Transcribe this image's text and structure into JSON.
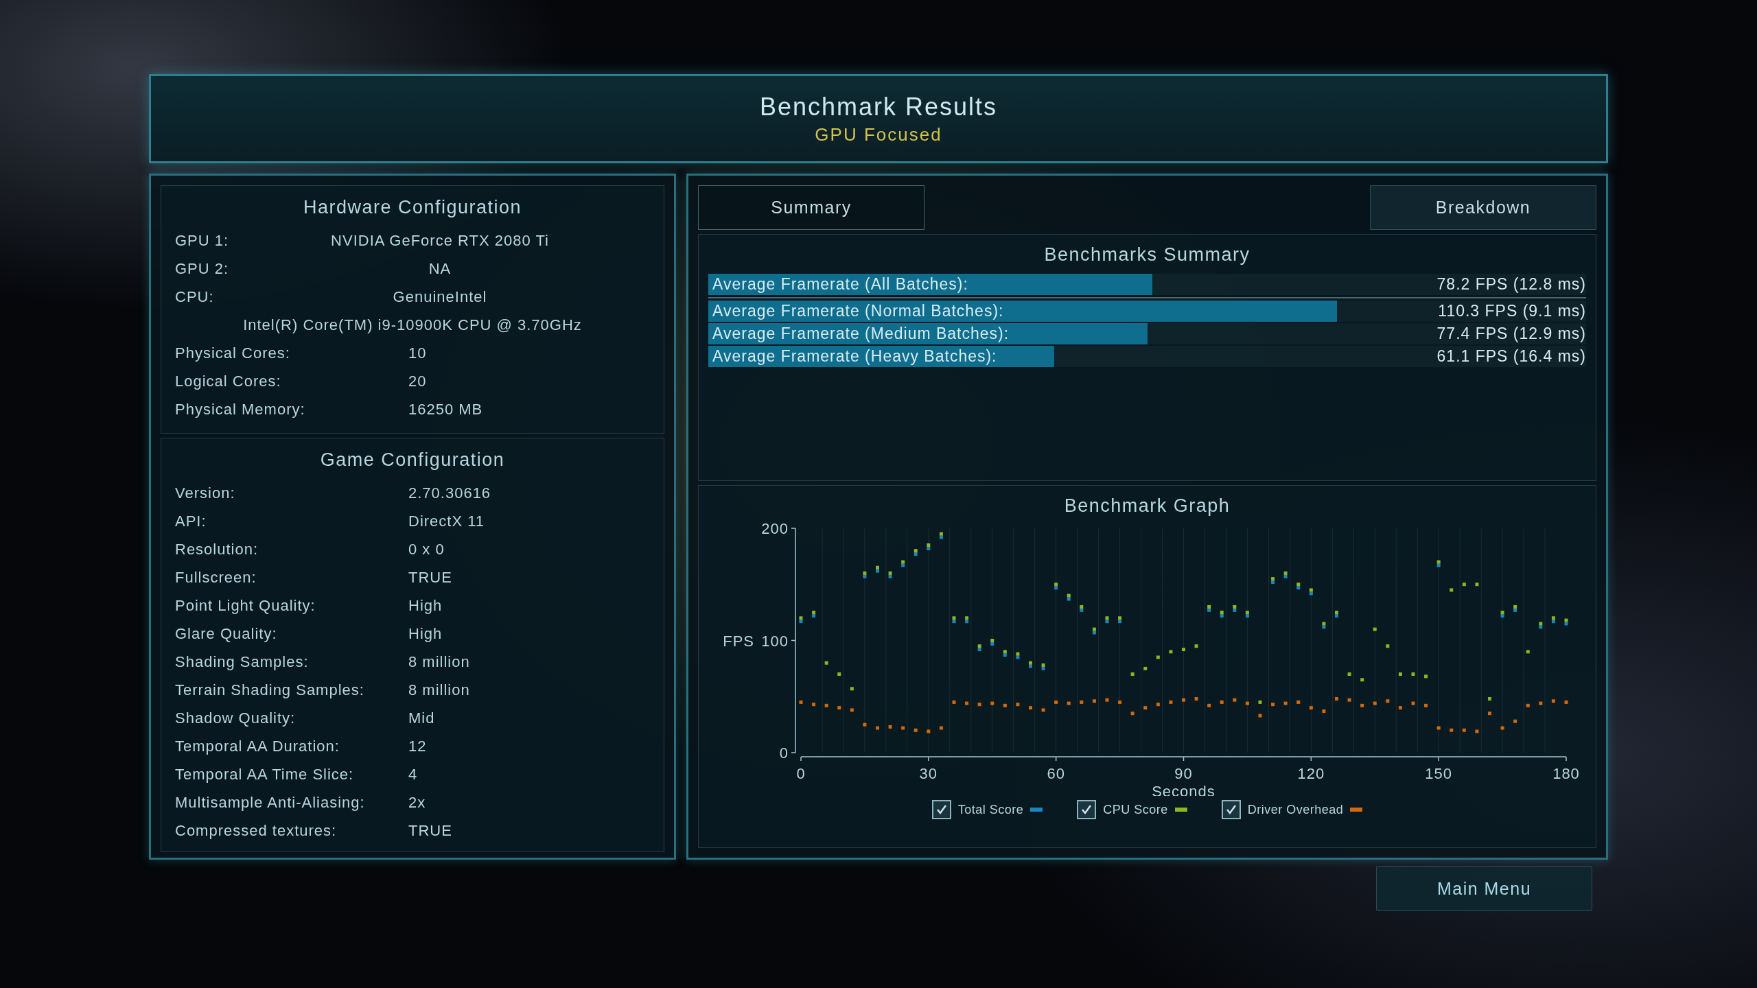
{
  "header": {
    "title": "Benchmark Results",
    "subtitle": "GPU Focused"
  },
  "hardware": {
    "title": "Hardware Configuration",
    "rows": [
      {
        "kind": "centered",
        "label": "GPU 1:",
        "value": "NVIDIA GeForce RTX 2080 Ti"
      },
      {
        "kind": "centered",
        "label": "GPU 2:",
        "value": "NA"
      },
      {
        "kind": "centered",
        "label": "CPU:",
        "value": "GenuineIntel"
      },
      {
        "kind": "line",
        "value": "Intel(R) Core(TM) i9-10900K CPU @ 3.70GHz"
      },
      {
        "kind": "column",
        "label": "Physical Cores:",
        "value": "10"
      },
      {
        "kind": "column",
        "label": "Logical Cores:",
        "value": "20"
      },
      {
        "kind": "column",
        "label": "Physical Memory:",
        "value": "16250  MB"
      }
    ]
  },
  "game": {
    "title": "Game Configuration",
    "rows": [
      {
        "label": "Version:",
        "value": "2.70.30616"
      },
      {
        "label": "API:",
        "value": "DirectX 11"
      },
      {
        "label": "Resolution:",
        "value": "0 x 0"
      },
      {
        "label": "Fullscreen:",
        "value": "TRUE"
      },
      {
        "label": "Point Light Quality:",
        "value": "High"
      },
      {
        "label": "Glare Quality:",
        "value": "High"
      },
      {
        "label": "Shading Samples:",
        "value": "8 million"
      },
      {
        "label": "Terrain Shading Samples:",
        "value": "8 million"
      },
      {
        "label": "Shadow Quality:",
        "value": "Mid"
      },
      {
        "label": "Temporal AA Duration:",
        "value": "12"
      },
      {
        "label": "Temporal AA Time Slice:",
        "value": "4"
      },
      {
        "label": "Multisample Anti-Aliasing:",
        "value": "2x"
      },
      {
        "label": "Compressed textures:",
        "value": "TRUE"
      }
    ]
  },
  "tabs": [
    {
      "label": "Summary",
      "selected": true
    },
    {
      "label": "Breakdown",
      "selected": false
    }
  ],
  "summary": {
    "title": "Benchmarks Summary",
    "rows": [
      {
        "label": "Average Framerate (All Batches):",
        "value": "78.2 FPS (12.8 ms)",
        "level": 0.506
      },
      {
        "label": "Average Framerate (Normal Batches):",
        "value": "110.3 FPS (9.1 ms)",
        "level": 0.716
      },
      {
        "label": "Average Framerate (Medium Batches):",
        "value": "77.4 FPS (12.9 ms)",
        "level": 0.5
      },
      {
        "label": "Average Framerate (Heavy Batches):",
        "value": "61.1 FPS (16.4 ms)",
        "level": 0.394
      }
    ]
  },
  "graph": {
    "title": "Benchmark Graph",
    "legend": [
      {
        "checked": true
      },
      {
        "checked": true
      },
      {
        "checked": true
      }
    ],
    "chart_data": {
      "type": "scatter",
      "grid": true,
      "xlabel": "Seconds",
      "ylabel": "FPS",
      "xlim": [
        0,
        180
      ],
      "ylim": [
        0,
        200
      ],
      "xticks": [
        0,
        30,
        60,
        90,
        120,
        150,
        180
      ],
      "yticks": [
        0,
        100,
        200
      ],
      "x": [
        0,
        3,
        6,
        9,
        12,
        15,
        18,
        21,
        24,
        27,
        30,
        33,
        36,
        39,
        42,
        45,
        48,
        51,
        54,
        57,
        60,
        63,
        66,
        69,
        72,
        75,
        78,
        81,
        84,
        87,
        90,
        93,
        96,
        99,
        102,
        105,
        108,
        111,
        114,
        117,
        120,
        123,
        126,
        129,
        132,
        135,
        138,
        141,
        144,
        147,
        150,
        153,
        156,
        159,
        162,
        165,
        168,
        171,
        174,
        177,
        180
      ],
      "series": [
        {
          "name": "Total Score",
          "color": "#1a86c0",
          "values": [
            117,
            122,
            null,
            null,
            null,
            157,
            162,
            157,
            167,
            177,
            182,
            192,
            117,
            117,
            92,
            97,
            87,
            85,
            77,
            75,
            147,
            137,
            127,
            107,
            117,
            117,
            null,
            null,
            null,
            null,
            null,
            null,
            127,
            122,
            127,
            122,
            null,
            152,
            157,
            147,
            142,
            112,
            122,
            null,
            null,
            null,
            null,
            null,
            null,
            null,
            167,
            null,
            null,
            null,
            null,
            122,
            127,
            null,
            112,
            117,
            115
          ]
        },
        {
          "name": "CPU Score",
          "color": "#8ab81e",
          "values": [
            120,
            125,
            80,
            70,
            57,
            160,
            165,
            160,
            170,
            180,
            185,
            195,
            120,
            120,
            95,
            100,
            90,
            88,
            80,
            78,
            150,
            140,
            130,
            110,
            120,
            120,
            70,
            75,
            85,
            90,
            92,
            95,
            130,
            125,
            130,
            125,
            45,
            155,
            160,
            150,
            145,
            115,
            125,
            70,
            65,
            110,
            95,
            70,
            70,
            68,
            170,
            145,
            150,
            150,
            48,
            125,
            130,
            90,
            115,
            120,
            118
          ]
        },
        {
          "name": "Driver Overhead",
          "color": "#d2690e",
          "values": [
            45,
            43,
            42,
            40,
            38,
            25,
            22,
            23,
            22,
            20,
            19,
            22,
            45,
            44,
            43,
            44,
            42,
            43,
            40,
            38,
            45,
            44,
            45,
            46,
            47,
            45,
            35,
            40,
            43,
            45,
            47,
            48,
            42,
            45,
            47,
            44,
            33,
            43,
            44,
            45,
            40,
            37,
            48,
            47,
            42,
            44,
            46,
            40,
            44,
            42,
            22,
            20,
            20,
            19,
            35,
            22,
            28,
            42,
            44,
            46,
            45
          ]
        }
      ]
    }
  },
  "buttons": [
    "Main Menu"
  ]
}
